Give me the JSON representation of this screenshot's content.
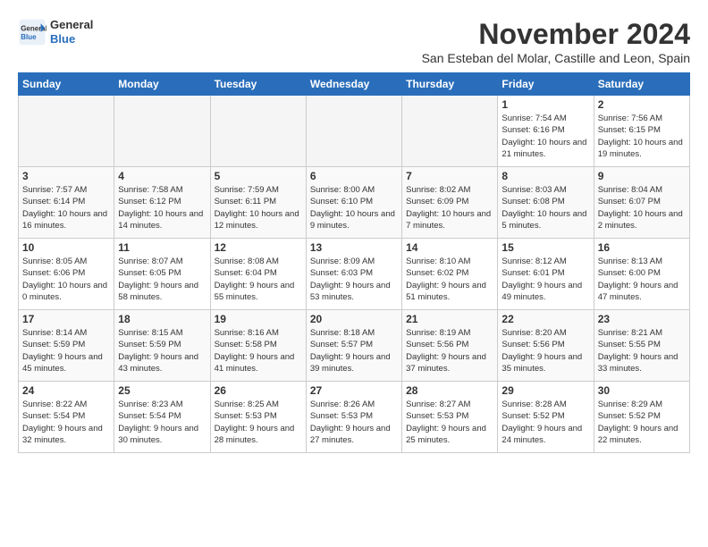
{
  "header": {
    "logo_line1": "General",
    "logo_line2": "Blue",
    "month": "November 2024",
    "location": "San Esteban del Molar, Castille and Leon, Spain"
  },
  "weekdays": [
    "Sunday",
    "Monday",
    "Tuesday",
    "Wednesday",
    "Thursday",
    "Friday",
    "Saturday"
  ],
  "weeks": [
    [
      {
        "day": "",
        "empty": true
      },
      {
        "day": "",
        "empty": true
      },
      {
        "day": "",
        "empty": true
      },
      {
        "day": "",
        "empty": true
      },
      {
        "day": "",
        "empty": true
      },
      {
        "day": "1",
        "sunrise": "Sunrise: 7:54 AM",
        "sunset": "Sunset: 6:16 PM",
        "daylight": "Daylight: 10 hours and 21 minutes."
      },
      {
        "day": "2",
        "sunrise": "Sunrise: 7:56 AM",
        "sunset": "Sunset: 6:15 PM",
        "daylight": "Daylight: 10 hours and 19 minutes."
      }
    ],
    [
      {
        "day": "3",
        "sunrise": "Sunrise: 7:57 AM",
        "sunset": "Sunset: 6:14 PM",
        "daylight": "Daylight: 10 hours and 16 minutes."
      },
      {
        "day": "4",
        "sunrise": "Sunrise: 7:58 AM",
        "sunset": "Sunset: 6:12 PM",
        "daylight": "Daylight: 10 hours and 14 minutes."
      },
      {
        "day": "5",
        "sunrise": "Sunrise: 7:59 AM",
        "sunset": "Sunset: 6:11 PM",
        "daylight": "Daylight: 10 hours and 12 minutes."
      },
      {
        "day": "6",
        "sunrise": "Sunrise: 8:00 AM",
        "sunset": "Sunset: 6:10 PM",
        "daylight": "Daylight: 10 hours and 9 minutes."
      },
      {
        "day": "7",
        "sunrise": "Sunrise: 8:02 AM",
        "sunset": "Sunset: 6:09 PM",
        "daylight": "Daylight: 10 hours and 7 minutes."
      },
      {
        "day": "8",
        "sunrise": "Sunrise: 8:03 AM",
        "sunset": "Sunset: 6:08 PM",
        "daylight": "Daylight: 10 hours and 5 minutes."
      },
      {
        "day": "9",
        "sunrise": "Sunrise: 8:04 AM",
        "sunset": "Sunset: 6:07 PM",
        "daylight": "Daylight: 10 hours and 2 minutes."
      }
    ],
    [
      {
        "day": "10",
        "sunrise": "Sunrise: 8:05 AM",
        "sunset": "Sunset: 6:06 PM",
        "daylight": "Daylight: 10 hours and 0 minutes."
      },
      {
        "day": "11",
        "sunrise": "Sunrise: 8:07 AM",
        "sunset": "Sunset: 6:05 PM",
        "daylight": "Daylight: 9 hours and 58 minutes."
      },
      {
        "day": "12",
        "sunrise": "Sunrise: 8:08 AM",
        "sunset": "Sunset: 6:04 PM",
        "daylight": "Daylight: 9 hours and 55 minutes."
      },
      {
        "day": "13",
        "sunrise": "Sunrise: 8:09 AM",
        "sunset": "Sunset: 6:03 PM",
        "daylight": "Daylight: 9 hours and 53 minutes."
      },
      {
        "day": "14",
        "sunrise": "Sunrise: 8:10 AM",
        "sunset": "Sunset: 6:02 PM",
        "daylight": "Daylight: 9 hours and 51 minutes."
      },
      {
        "day": "15",
        "sunrise": "Sunrise: 8:12 AM",
        "sunset": "Sunset: 6:01 PM",
        "daylight": "Daylight: 9 hours and 49 minutes."
      },
      {
        "day": "16",
        "sunrise": "Sunrise: 8:13 AM",
        "sunset": "Sunset: 6:00 PM",
        "daylight": "Daylight: 9 hours and 47 minutes."
      }
    ],
    [
      {
        "day": "17",
        "sunrise": "Sunrise: 8:14 AM",
        "sunset": "Sunset: 5:59 PM",
        "daylight": "Daylight: 9 hours and 45 minutes."
      },
      {
        "day": "18",
        "sunrise": "Sunrise: 8:15 AM",
        "sunset": "Sunset: 5:59 PM",
        "daylight": "Daylight: 9 hours and 43 minutes."
      },
      {
        "day": "19",
        "sunrise": "Sunrise: 8:16 AM",
        "sunset": "Sunset: 5:58 PM",
        "daylight": "Daylight: 9 hours and 41 minutes."
      },
      {
        "day": "20",
        "sunrise": "Sunrise: 8:18 AM",
        "sunset": "Sunset: 5:57 PM",
        "daylight": "Daylight: 9 hours and 39 minutes."
      },
      {
        "day": "21",
        "sunrise": "Sunrise: 8:19 AM",
        "sunset": "Sunset: 5:56 PM",
        "daylight": "Daylight: 9 hours and 37 minutes."
      },
      {
        "day": "22",
        "sunrise": "Sunrise: 8:20 AM",
        "sunset": "Sunset: 5:56 PM",
        "daylight": "Daylight: 9 hours and 35 minutes."
      },
      {
        "day": "23",
        "sunrise": "Sunrise: 8:21 AM",
        "sunset": "Sunset: 5:55 PM",
        "daylight": "Daylight: 9 hours and 33 minutes."
      }
    ],
    [
      {
        "day": "24",
        "sunrise": "Sunrise: 8:22 AM",
        "sunset": "Sunset: 5:54 PM",
        "daylight": "Daylight: 9 hours and 32 minutes."
      },
      {
        "day": "25",
        "sunrise": "Sunrise: 8:23 AM",
        "sunset": "Sunset: 5:54 PM",
        "daylight": "Daylight: 9 hours and 30 minutes."
      },
      {
        "day": "26",
        "sunrise": "Sunrise: 8:25 AM",
        "sunset": "Sunset: 5:53 PM",
        "daylight": "Daylight: 9 hours and 28 minutes."
      },
      {
        "day": "27",
        "sunrise": "Sunrise: 8:26 AM",
        "sunset": "Sunset: 5:53 PM",
        "daylight": "Daylight: 9 hours and 27 minutes."
      },
      {
        "day": "28",
        "sunrise": "Sunrise: 8:27 AM",
        "sunset": "Sunset: 5:53 PM",
        "daylight": "Daylight: 9 hours and 25 minutes."
      },
      {
        "day": "29",
        "sunrise": "Sunrise: 8:28 AM",
        "sunset": "Sunset: 5:52 PM",
        "daylight": "Daylight: 9 hours and 24 minutes."
      },
      {
        "day": "30",
        "sunrise": "Sunrise: 8:29 AM",
        "sunset": "Sunset: 5:52 PM",
        "daylight": "Daylight: 9 hours and 22 minutes."
      }
    ]
  ]
}
